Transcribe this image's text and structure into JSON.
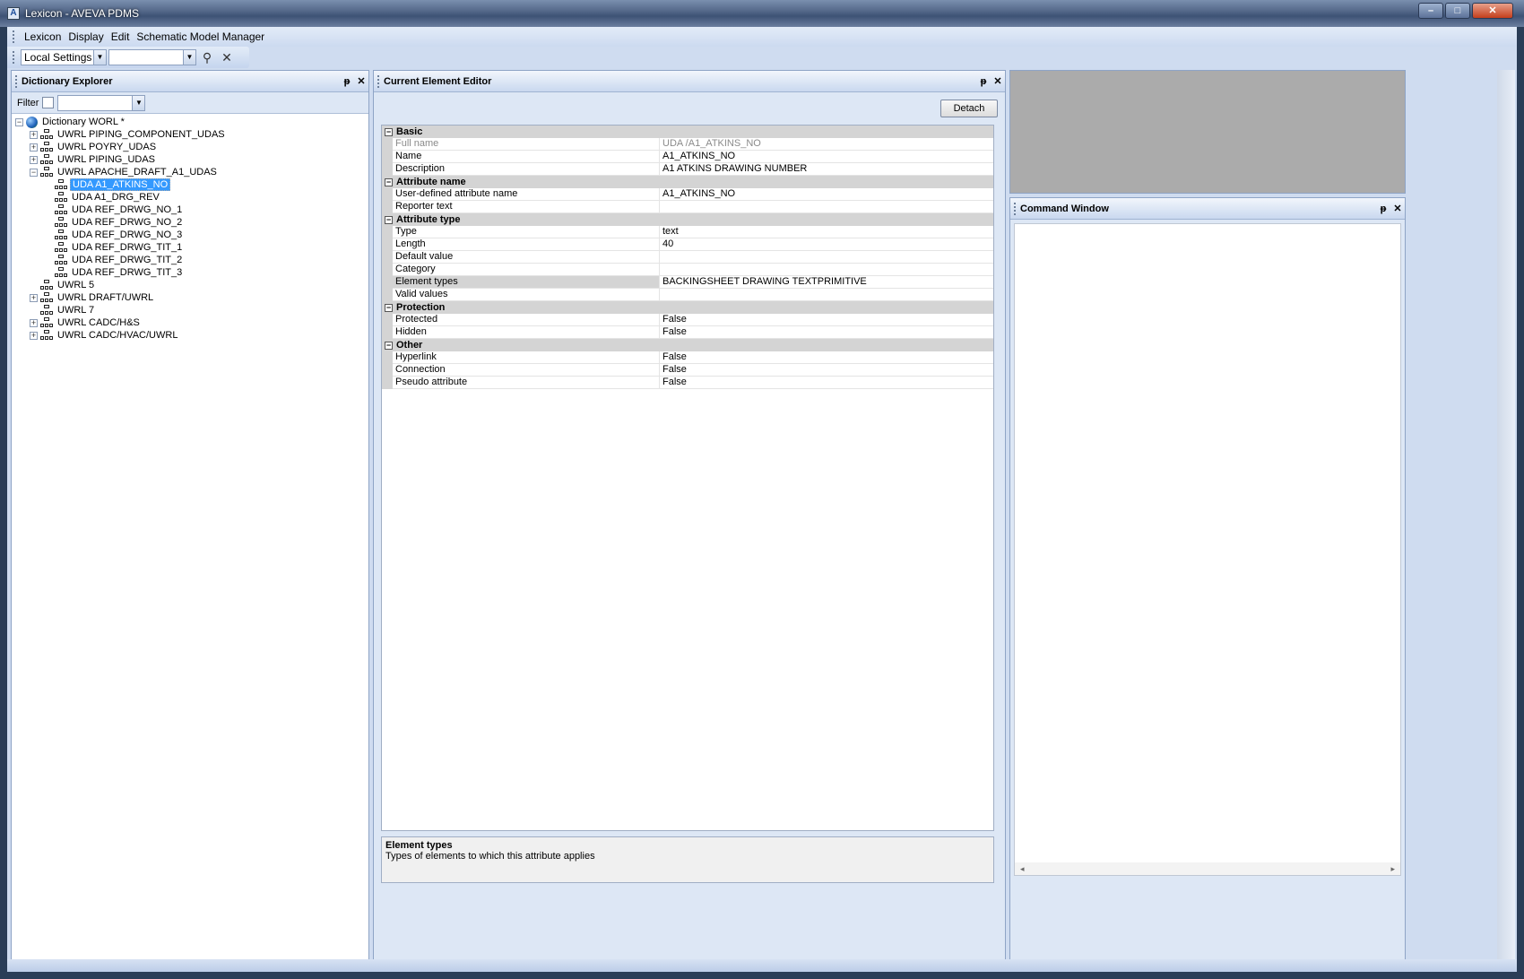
{
  "window": {
    "title": "Lexicon - AVEVA PDMS",
    "app_icon_letter": "A",
    "buttons": {
      "minimize": "–",
      "maximize": "□",
      "close": "✕"
    }
  },
  "menubar": {
    "items": [
      "Lexicon",
      "Display",
      "Edit",
      "Schematic Model Manager"
    ]
  },
  "toolbar": {
    "settings_value": "Local Settings",
    "search_icon": "binoculars-icon",
    "close_icon": "close-icon"
  },
  "explorer": {
    "title": "Dictionary Explorer",
    "filter_label": "Filter",
    "filter_value": "",
    "tree": {
      "root": "Dictionary WORL *",
      "nodes": [
        {
          "label": "UWRL PIPING_COMPONENT_UDAS",
          "expander": "+"
        },
        {
          "label": "UWRL POYRY_UDAS",
          "expander": "+"
        },
        {
          "label": "UWRL PIPING_UDAS",
          "expander": "+"
        },
        {
          "label": "UWRL APACHE_DRAFT_A1_UDAS",
          "expander": "−"
        },
        {
          "label": "UWRL 5",
          "expander": ""
        },
        {
          "label": "UWRL DRAFT/UWRL",
          "expander": "+"
        },
        {
          "label": "UWRL 7",
          "expander": ""
        },
        {
          "label": "UWRL CADC/H&S",
          "expander": "+"
        },
        {
          "label": "UWRL CADC/HVAC/UWRL",
          "expander": "+"
        }
      ],
      "children": [
        "UDA A1_ATKINS_NO",
        "UDA A1_DRG_REV",
        "UDA REF_DRWG_NO_1",
        "UDA REF_DRWG_NO_2",
        "UDA REF_DRWG_NO_3",
        "UDA REF_DRWG_TIT_1",
        "UDA REF_DRWG_TIT_2",
        "UDA REF_DRWG_TIT_3"
      ]
    }
  },
  "editor": {
    "title": "Current Element Editor",
    "detach_label": "Detach",
    "categories": [
      {
        "name": "Basic",
        "rows": [
          {
            "name": "Full name",
            "value": "UDA /A1_ATKINS_NO",
            "readonly": true
          },
          {
            "name": "Name",
            "value": "A1_ATKINS_NO"
          },
          {
            "name": "Description",
            "value": "A1 ATKINS DRAWING NUMBER"
          }
        ]
      },
      {
        "name": "Attribute name",
        "rows": [
          {
            "name": "User-defined attribute name",
            "value": "A1_ATKINS_NO"
          },
          {
            "name": "Reporter text",
            "value": ""
          }
        ]
      },
      {
        "name": "Attribute type",
        "rows": [
          {
            "name": "Type",
            "value": "text"
          },
          {
            "name": "Length",
            "value": "40"
          },
          {
            "name": "Default value",
            "value": ""
          },
          {
            "name": "Category",
            "value": ""
          },
          {
            "name": "Element types",
            "value": "BACKINGSHEET DRAWING TEXTPRIMITIVE",
            "selected": true
          },
          {
            "name": "Valid values",
            "value": ""
          }
        ]
      },
      {
        "name": "Protection",
        "rows": [
          {
            "name": "Protected",
            "value": "False"
          },
          {
            "name": "Hidden",
            "value": "False"
          }
        ]
      },
      {
        "name": "Other",
        "rows": [
          {
            "name": "Hyperlink",
            "value": "False"
          },
          {
            "name": "Connection",
            "value": "False"
          },
          {
            "name": "Pseudo attribute",
            "value": "False"
          }
        ]
      }
    ],
    "help": {
      "title": "Element types",
      "text": "Types of elements to which this attribute applies"
    }
  },
  "command_window": {
    "title": "Command Window"
  },
  "panel_buttons": {
    "pin": "ᵽ",
    "close": "✕"
  }
}
